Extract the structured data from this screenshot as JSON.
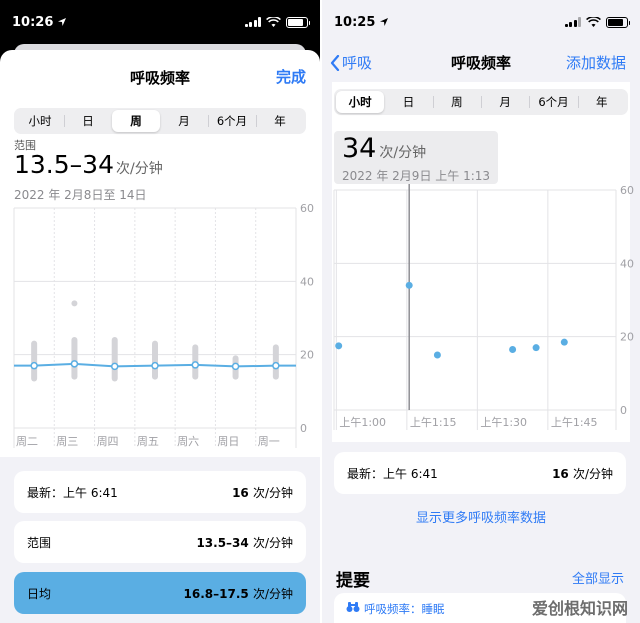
{
  "left": {
    "status_time": "10:26",
    "sheet_title": "呼吸频率",
    "done_label": "完成",
    "segments": [
      "小时",
      "日",
      "周",
      "月",
      "6个月",
      "年"
    ],
    "active_segment": 2,
    "range_label": "范围",
    "range_value": "13.5–34",
    "unit": "次/分钟",
    "date_range": "2022 年 2月8日至 14日",
    "latest_label": "最新：上午 6:41",
    "latest_value": "16",
    "range_card_label": "范围",
    "range_card_value": "13.5–34",
    "daily_avg_label": "日均",
    "daily_avg_value": "16.8–17.5",
    "card_unit": "次/分钟"
  },
  "right": {
    "status_time": "10:25",
    "back_label": "呼吸",
    "nav_title": "呼吸频率",
    "add_label": "添加数据",
    "segments": [
      "小时",
      "日",
      "周",
      "月",
      "6个月",
      "年"
    ],
    "active_segment": 0,
    "selected_value": "34",
    "unit": "次/分钟",
    "selected_date": "2022 年 2月9日 上午 1:13",
    "latest_label": "最新：上午 6:41",
    "latest_value": "16",
    "card_unit": "次/分钟",
    "more_link": "显示更多呼吸频率数据",
    "summary_title": "提要",
    "show_all": "全部显示",
    "summary_item": "呼吸频率：睡眠",
    "watermark": "爱创根知识网"
  },
  "colors": {
    "accent": "#2f7bf5",
    "series": "#5aaee3",
    "range_bar": "#d4d4d8"
  },
  "chart_data": [
    {
      "type": "line",
      "x": [
        "周二",
        "周三",
        "周四",
        "周五",
        "周六",
        "周日",
        "周一"
      ],
      "series": [
        {
          "values": [
            17,
            17.5,
            16.8,
            17,
            17.2,
            16.8,
            17
          ]
        },
        {
          "values": [
            [
              13.5,
              23
            ],
            [
              14,
              34
            ],
            [
              13.5,
              24
            ],
            [
              14,
              23
            ],
            [
              14,
              22
            ],
            [
              14,
              19
            ],
            [
              14,
              22
            ]
          ]
        }
      ],
      "y_ticks": [
        "60",
        "40",
        "20",
        "0"
      ],
      "ylim": [
        0,
        60
      ],
      "grid": true
    },
    {
      "type": "scatter",
      "x_ticks": [
        "上午1:00",
        "上午1:15",
        "上午1:30",
        "上午1:45"
      ],
      "x_numeric": [
        0,
        15,
        30,
        45
      ],
      "series": [
        {
          "x": [
            -2,
            13,
            19,
            35,
            40,
            46
          ],
          "y": [
            17.5,
            34,
            15,
            16.5,
            17,
            18.5
          ]
        }
      ],
      "selected_x": 13,
      "y_ticks": [
        "60",
        "40",
        "20",
        "0"
      ],
      "ylim": [
        0,
        60
      ],
      "grid": true
    }
  ]
}
